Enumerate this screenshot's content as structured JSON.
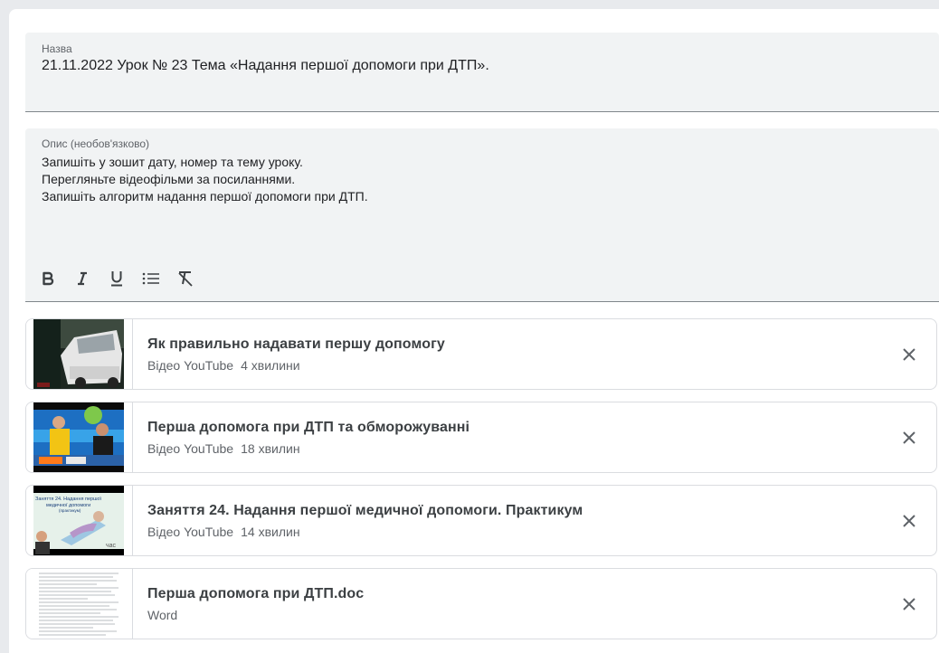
{
  "title_field": {
    "label": "Назва",
    "value": "21.11.2022  Урок № 23 Тема «Надання першої допомоги при ДТП»."
  },
  "description_field": {
    "label": "Опис (необов'язково)",
    "lines": [
      "Запишіть у зошит дату, номер та тему уроку.",
      "Перегляньте відеофільми за посиланнями.",
      "Запишіть алгоритм надання першої допомоги при ДТП."
    ]
  },
  "toolbar": {
    "icons": [
      "bold-icon",
      "italic-icon",
      "underline-icon",
      "bulleted-list-icon",
      "clear-formatting-icon"
    ]
  },
  "attachments": [
    {
      "title": "Як правильно надавати першу допомогу",
      "type": "Відео YouTube",
      "duration": "4 хвилини",
      "thumbnail": "video-thumbnail-car"
    },
    {
      "title": "Перша допомога при ДТП та обморожуванні",
      "type": "Відео YouTube",
      "duration": "18 хвилин",
      "thumbnail": "video-thumbnail-studio"
    },
    {
      "title": "Заняття 24. Надання першої медичної допомоги. Практикум",
      "type": "Відео YouTube",
      "duration": "14 хвилин",
      "thumbnail": "video-thumbnail-lesson",
      "thumbnail_text": [
        "Заняття 24. Надання першої",
        "медичної допомоги",
        "(практикум)",
        "час"
      ]
    },
    {
      "title": "Перша допомога при ДТП.doc",
      "type": "Word",
      "thumbnail": "document-thumbnail"
    }
  ],
  "colors": {
    "page_bg": "#e8eaed",
    "field_bg": "#f1f3f4",
    "border": "#dadce0",
    "text": "#202124",
    "secondary_text": "#5f6368"
  }
}
